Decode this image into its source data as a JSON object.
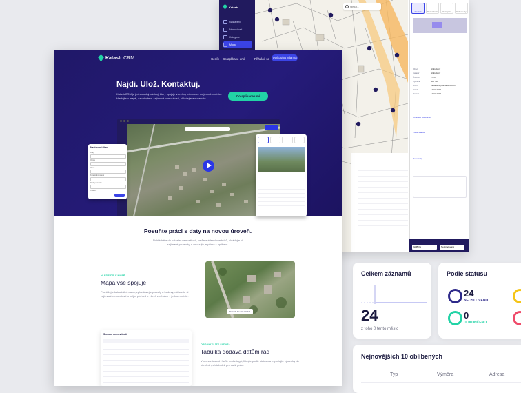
{
  "brand": {
    "name_bold": "Katastr",
    "name_light": "CRM"
  },
  "app": {
    "sidebar": [
      {
        "label": "Nastavení"
      },
      {
        "label": "Nemovitosti"
      },
      {
        "label": "Kategorie"
      },
      {
        "label": "Mapa"
      }
    ],
    "search_placeholder": "Hledat...",
    "panel_tabs": [
      "Přehled",
      "Nemovitosti",
      "Kategorie",
      "Dokumenty"
    ],
    "panel_fields": [
      {
        "label": "Obec",
        "value": "Hlubočepy"
      },
      {
        "label": "Katastr",
        "value": "Hlubočepy"
      },
      {
        "label": "Číslo LV",
        "value": "2779"
      },
      {
        "label": "Výměra",
        "value": "800 m2"
      },
      {
        "label": "Druh",
        "value": "zastavěná plocha a nádvoří"
      },
      {
        "label": "Vznik",
        "value": "12.03.2024"
      },
      {
        "label": "Změna",
        "value": "12.03.2024"
      }
    ],
    "panel_sections": [
      "Omezení vlastnictví",
      "Podle statusu",
      "Poznámky",
      "Oblíbené"
    ],
    "select_left": "GDBOS",
    "select_right": "Nezpracovaný"
  },
  "landing": {
    "nav": [
      "Ceník",
      "Co aplikace umí",
      "Přihlásit se"
    ],
    "nav_cta": "Vyzkoušet zdarma",
    "hero_title": "Najdi. Ulož. Kontaktuj.",
    "hero_text": "KatastrCRM je jednoduchý nástroj, který spojuje všechny informace do jednoho místa. Hledejte v mapě, označujte si zajímavé nemovitosti, ukládejte a spravujte.",
    "hero_cta": "Co aplikace umí",
    "filter_title": "Nastavení filtru",
    "filter_fields": [
      "Kraj",
      "Okres",
      "Obec",
      "Katastrální území",
      "Druh pozemku",
      "Vlastník"
    ],
    "section_title": "Posuňte práci s daty na novou úroveň.",
    "section_text": "Nahlédněte do katastru nemovitostí, veďte evidenci vlastníků, ukládejte si zajímavé pozemky a oslovujte je přímo z aplikace.",
    "feature1": {
      "eyebrow": "HLEDEJTE V MAPĚ",
      "title": "Mapa vše spojuje",
      "text": "Prohlížejte katastrální mapu, vyhledávejte parcely a budovy, ukládejte si zajímavé nemovitosti a mějte přehled o všech změnách v jednom místě.",
      "map_button": "Zobrazit 1 a více tlačítek"
    },
    "feature2": {
      "eyebrow": "ORGANIZUJTE SI DATA",
      "title": "Tabulka dodává datům řád",
      "text": "V nemovitostech řaďte podle tagů, filtrujte podle statusu a exportujte výsledky do přehledných tabulek pro další práci.",
      "table_title": "Seznam nemovitostí"
    }
  },
  "stats": {
    "total_title": "Celkem záznamů",
    "total_value": "24",
    "total_sub": "z toho 0 tento měsíc",
    "status_title": "Podle statusu",
    "status_items": [
      {
        "value": "24",
        "label": "NEOSLOVENO",
        "color": "#2e2a8a"
      },
      {
        "value": "0",
        "label": "DOKONČENO",
        "color": "#22d3a6"
      }
    ],
    "favorites_title": "Nejnovějších 10 oblíbených",
    "table_headers": [
      "Typ",
      "Výměra",
      "Adresa"
    ]
  },
  "colors": {
    "brand": "#1f1566",
    "accent": "#22d3a6",
    "primary": "#3b44e6"
  }
}
